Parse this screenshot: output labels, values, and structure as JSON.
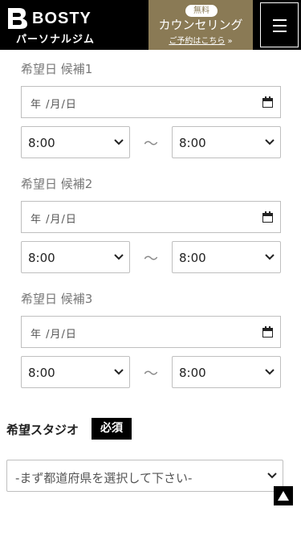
{
  "header": {
    "logo_text": "BOSTY",
    "logo_sub": "パーソナルジム",
    "counsel_badge": "無料",
    "counsel_title": "カウンセリング",
    "counsel_link": "ご予約はこちら",
    "counsel_arrow": "»",
    "menu_icon": "hamburger-icon"
  },
  "candidates": [
    {
      "label": "希望日 候補1",
      "date_placeholder": "年 /月/日",
      "start": "8:00",
      "end": "8:00"
    },
    {
      "label": "希望日 候補2",
      "date_placeholder": "年 /月/日",
      "start": "8:00",
      "end": "8:00"
    },
    {
      "label": "希望日 候補3",
      "date_placeholder": "年 /月/日",
      "start": "8:00",
      "end": "8:00"
    }
  ],
  "range_separator": "〜",
  "studio": {
    "label": "希望スタジオ",
    "required_badge": "必須",
    "placeholder": "-まず都道府県を選択して下さい-"
  },
  "colors": {
    "header_bg": "#000000",
    "accent_gold": "#8a7a55"
  }
}
